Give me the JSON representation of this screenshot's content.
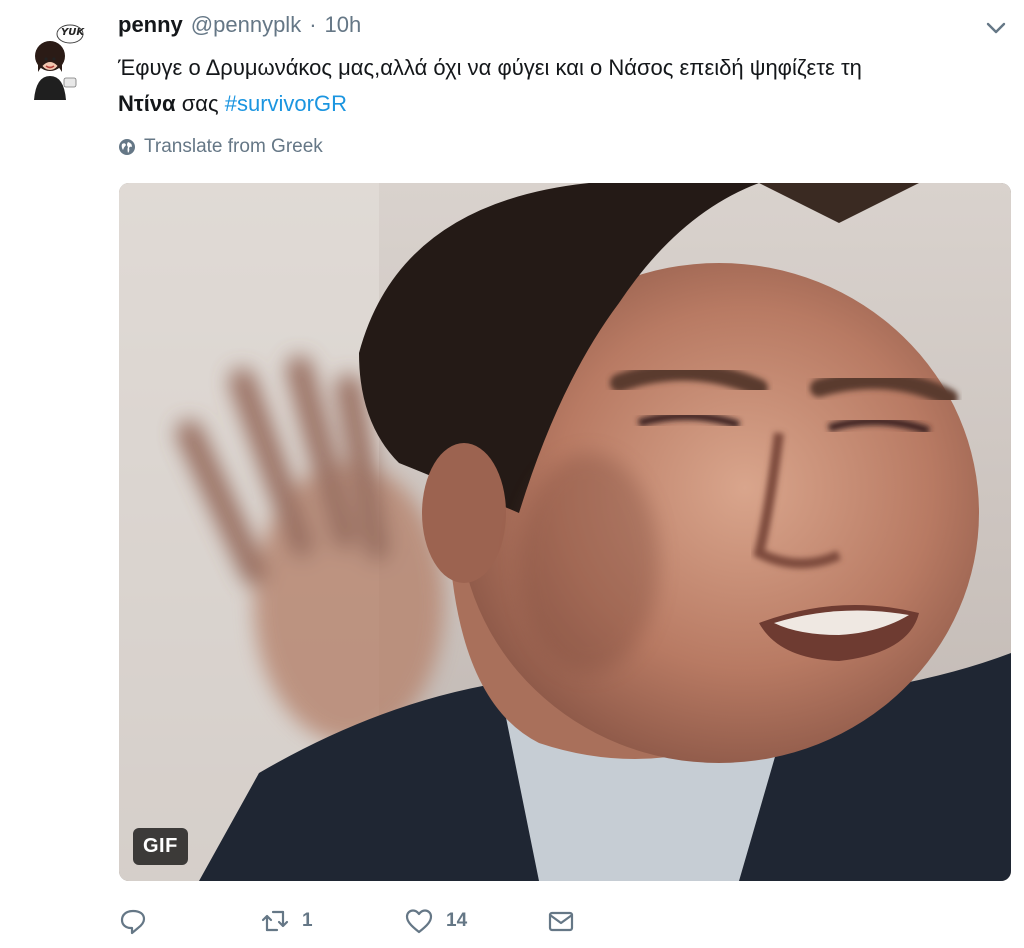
{
  "user": {
    "display_name": "penny",
    "handle": "@pennyplk",
    "separator": "·",
    "time": "10h",
    "avatar_badge": "YUK"
  },
  "tweet": {
    "text_line1": "Έφυγε ο Δρυμωνάκος μας,αλλά όχι να φύγει και ο Νάσος επειδή ψηφίζετε τη",
    "bold_word": "Ντίνα",
    "text_after": "σας",
    "hashtag": "#survivorGR",
    "translate_label": "Translate from Greek"
  },
  "media": {
    "badge": "GIF"
  },
  "actions": {
    "retweet_count": "1",
    "like_count": "14"
  },
  "icons": {
    "caret": "chevron-down-icon",
    "translate": "globe-icon",
    "reply": "reply-icon",
    "retweet": "retweet-icon",
    "like": "heart-icon",
    "dm": "envelope-icon"
  },
  "colors": {
    "link": "#1b95e0",
    "muted": "#657786",
    "text": "#14171a"
  }
}
